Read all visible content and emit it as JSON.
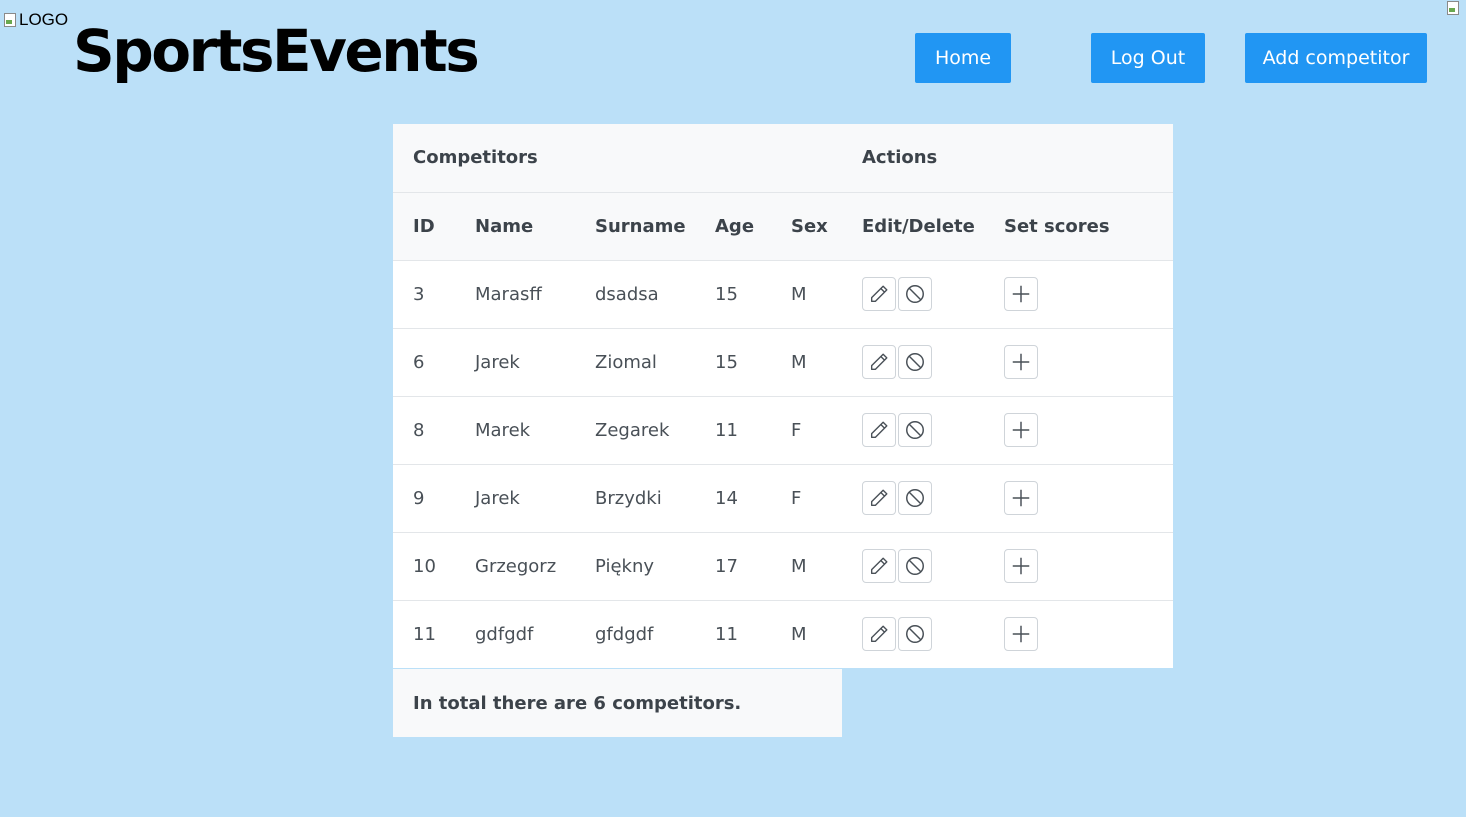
{
  "header": {
    "logo_alt": "LOGO",
    "brand": "SportsEvents",
    "nav": {
      "home": "Home",
      "logout": "Log Out",
      "add": "Add competitor"
    }
  },
  "table": {
    "group_headers": {
      "competitors": "Competitors",
      "actions": "Actions"
    },
    "columns": {
      "id": "ID",
      "name": "Name",
      "surname": "Surname",
      "age": "Age",
      "sex": "Sex",
      "edit_delete": "Edit/Delete",
      "set_scores": "Set scores"
    },
    "rows": [
      {
        "id": "3",
        "name": "Marasff",
        "surname": "dsadsa",
        "age": "15",
        "sex": "M"
      },
      {
        "id": "6",
        "name": "Jarek",
        "surname": "Ziomal",
        "age": "15",
        "sex": "M"
      },
      {
        "id": "8",
        "name": "Marek",
        "surname": "Zegarek",
        "age": "11",
        "sex": "F"
      },
      {
        "id": "9",
        "name": "Jarek",
        "surname": "Brzydki",
        "age": "14",
        "sex": "F"
      },
      {
        "id": "10",
        "name": "Grzegorz",
        "surname": "Piękny",
        "age": "17",
        "sex": "M"
      },
      {
        "id": "11",
        "name": "gdfgdf",
        "surname": "gfdgdf",
        "age": "11",
        "sex": "M"
      }
    ],
    "icons": {
      "edit": "pencil-icon",
      "delete": "ban-icon",
      "set": "plus-icon"
    },
    "footer": "In total there are 6 competitors."
  },
  "colors": {
    "background": "#bbe0f8",
    "accent": "#2196f3"
  }
}
